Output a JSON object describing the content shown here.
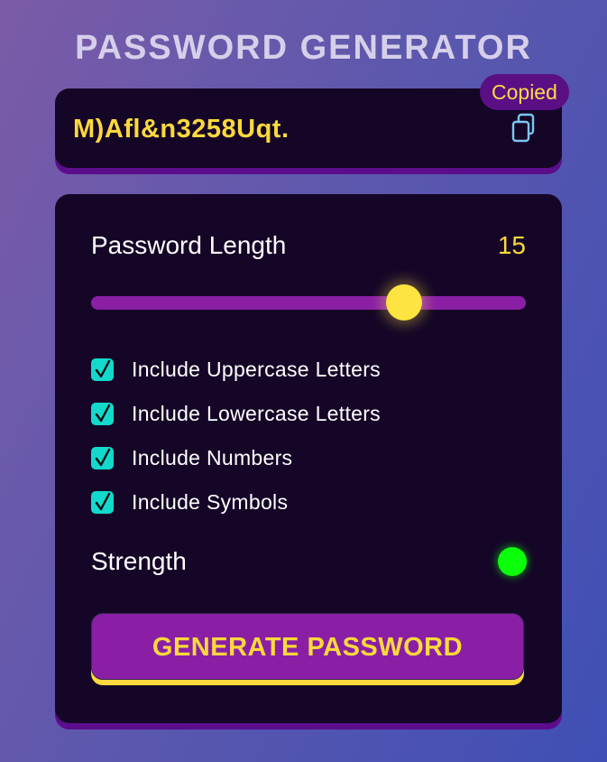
{
  "app": {
    "title": "PASSWORD GENERATOR"
  },
  "password": {
    "value": "M)Afl&n3258Uqt.",
    "copy_icon": "copy-icon",
    "copied_badge": "Copied"
  },
  "settings": {
    "length_label": "Password Length",
    "length_value": "15",
    "slider_level": 0.72,
    "options": [
      {
        "label": "Include Uppercase Letters",
        "checked": true
      },
      {
        "label": "Include Lowercase Letters",
        "checked": true
      },
      {
        "label": "Include Numbers",
        "checked": true
      },
      {
        "label": "Include Symbols",
        "checked": true
      }
    ],
    "strength_label": "Strength",
    "strength_color": "#0bff0b",
    "generate_label": "GENERATE PASSWORD"
  },
  "colors": {
    "accent_yellow": "#fcd93d",
    "accent_purple": "#8a1fa6",
    "checkbox_teal": "#12d9cc",
    "card_background": "#150627"
  }
}
